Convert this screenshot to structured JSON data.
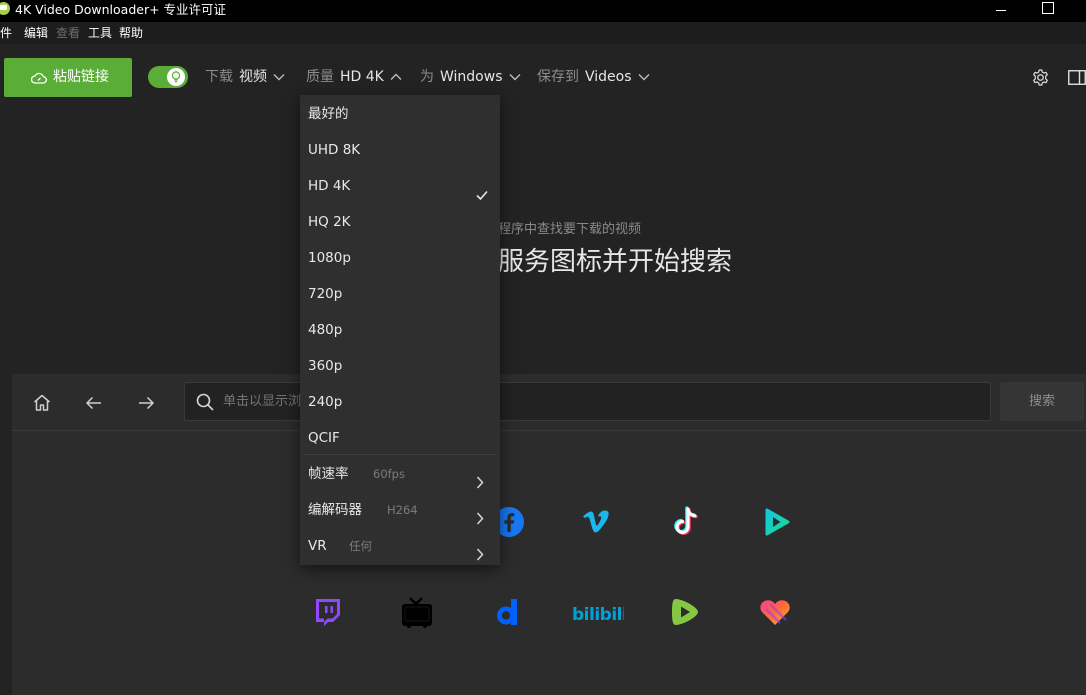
{
  "window": {
    "title": "4K Video Downloader+ 专业许可证"
  },
  "menu": {
    "items": [
      {
        "label": "文件",
        "disabled": false
      },
      {
        "label": "编辑",
        "disabled": false
      },
      {
        "label": "查看",
        "disabled": true
      },
      {
        "label": "工具",
        "disabled": false
      },
      {
        "label": "帮助",
        "disabled": false
      }
    ]
  },
  "toolbar": {
    "paste_label": "粘贴链接",
    "smart_mode_on": true,
    "download": {
      "key": "下载",
      "value": "视频"
    },
    "quality": {
      "key": "质量",
      "value": "HD 4K"
    },
    "platform": {
      "key": "为",
      "value": "Windows"
    },
    "save_to": {
      "key": "保存到",
      "value": "Videos"
    }
  },
  "empty_state": {
    "hint_small": "程序中查找要下载的视频",
    "hint_big": "服务图标并开始搜索"
  },
  "browser": {
    "search_placeholder": "单击以显示浏",
    "search_button": "搜索",
    "services_row1": [
      "facebook-icon",
      "vimeo-icon",
      "tiktok-icon",
      "youtube-music-icon"
    ],
    "services_row2": [
      "twitch-icon",
      "niconico-icon",
      "dailymotion-icon",
      "bilibili-icon",
      "rumble-icon",
      "likee-icon"
    ]
  },
  "quality_dropdown": {
    "selected": "HD 4K",
    "options": [
      "最好的",
      "UHD 8K",
      "HD 4K",
      "HQ 2K",
      "1080p",
      "720p",
      "480p",
      "360p",
      "240p",
      "QCIF"
    ],
    "submenus": [
      {
        "label": "帧速率",
        "value": "60fps"
      },
      {
        "label": "编解码器",
        "value": "H264"
      },
      {
        "label": "VR",
        "value": "任何"
      }
    ]
  },
  "colors": {
    "accent_green": "#5aae37",
    "background": "#232323",
    "panel": "#2c2c2c",
    "dropdown": "#2f2f2f"
  }
}
